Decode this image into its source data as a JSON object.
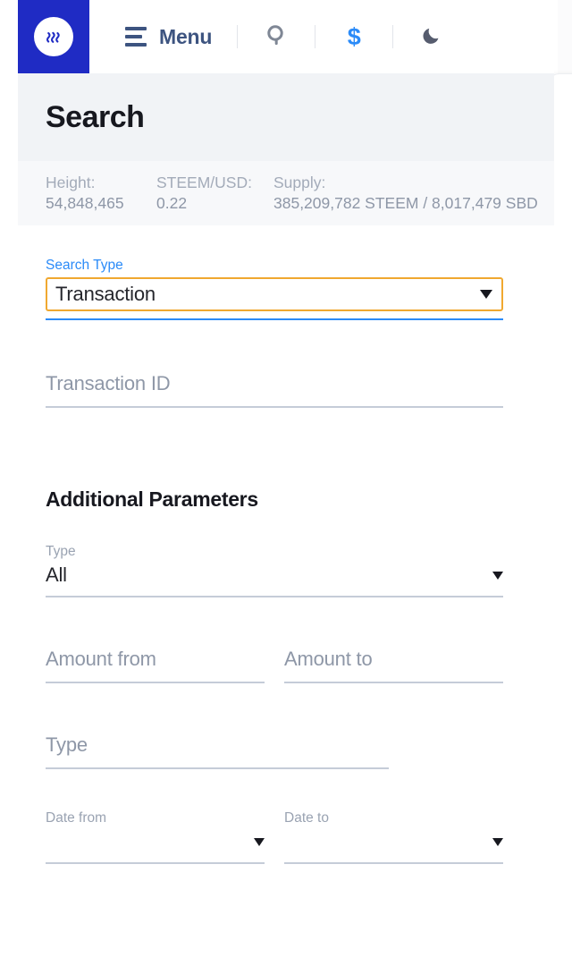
{
  "brand": {
    "logo_icon": "steem-logo-icon",
    "logo_color": "#1f2bc4"
  },
  "topbar": {
    "menu_label": "Menu",
    "menu_icon": "hamburger-menu-icon",
    "search_icon": "search-icon",
    "price_icon": "dollar-sign-icon",
    "theme_icon": "moon-dark-mode-icon",
    "accent_blue": "#2b8bf8",
    "icon_grey": "#7f8795"
  },
  "header": {
    "title": "Search"
  },
  "stats": [
    {
      "key": "Height:",
      "value": "54,848,465"
    },
    {
      "key": "STEEM/USD:",
      "value": "0.22"
    },
    {
      "key": "Supply:",
      "value": "385,209,782 STEEM / 8,017,479 SBD"
    }
  ],
  "search_form": {
    "search_type": {
      "label": "Search Type",
      "value": "Transaction",
      "focus_color": "#f0a830",
      "underline_color": "#2b8bf8"
    },
    "transaction_id": {
      "placeholder": "Transaction ID",
      "value": ""
    }
  },
  "additional": {
    "heading": "Additional Parameters",
    "type_select": {
      "label": "Type",
      "value": "All"
    },
    "amount_from": {
      "placeholder": "Amount from",
      "value": ""
    },
    "amount_to": {
      "placeholder": "Amount to",
      "value": ""
    },
    "type_input": {
      "placeholder": "Type",
      "value": ""
    },
    "date_from": {
      "label": "Date from",
      "value": ""
    },
    "date_to": {
      "label": "Date to",
      "value": ""
    }
  }
}
